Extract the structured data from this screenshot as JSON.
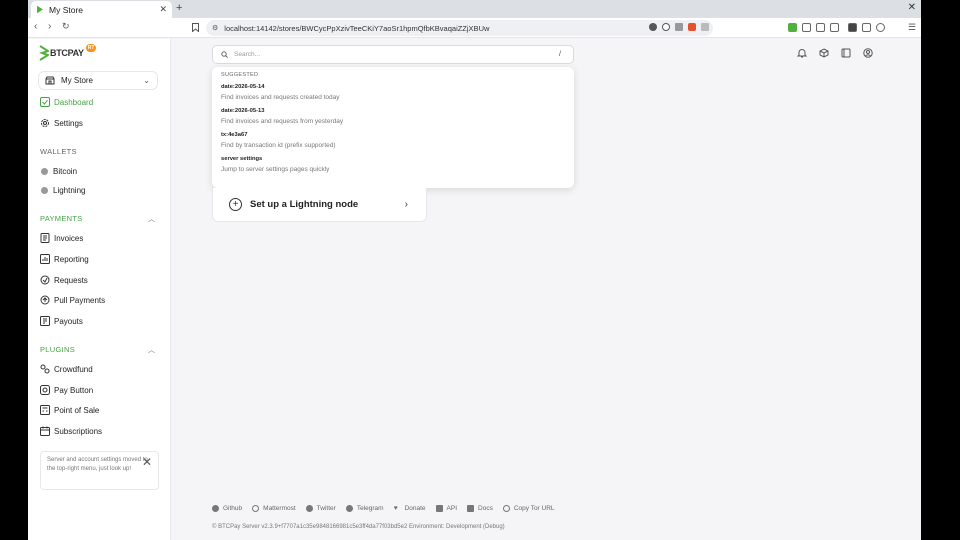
{
  "browser": {
    "tab_title": "My Store",
    "url": "localhost:14142/stores/BWCycPpXzivTeeCKiY7aoSr1hpmQfbKBvaqaiZZjXBUw"
  },
  "sidebar": {
    "logo_text": "BTCPAY",
    "logo_badge": "RT",
    "store_name": "My Store",
    "nav": [
      {
        "label": "Dashboard",
        "icon": "dashboard-icon"
      },
      {
        "label": "Settings",
        "icon": "gear-icon"
      }
    ],
    "wallets_header": "WALLETS",
    "wallets": [
      {
        "label": "Bitcoin",
        "icon": "bitcoin-icon"
      },
      {
        "label": "Lightning",
        "icon": "lightning-icon"
      }
    ],
    "payments_header": "PAYMENTS",
    "payments": [
      {
        "label": "Invoices",
        "icon": "invoice-icon"
      },
      {
        "label": "Reporting",
        "icon": "reporting-icon"
      },
      {
        "label": "Requests",
        "icon": "requests-icon"
      },
      {
        "label": "Pull Payments",
        "icon": "pull-payments-icon"
      },
      {
        "label": "Payouts",
        "icon": "payouts-icon"
      }
    ],
    "plugins_header": "PLUGINS",
    "plugins": [
      {
        "label": "Crowdfund",
        "icon": "crowdfund-icon"
      },
      {
        "label": "Pay Button",
        "icon": "pay-button-icon"
      },
      {
        "label": "Point of Sale",
        "icon": "pos-icon"
      },
      {
        "label": "Subscriptions",
        "icon": "subscriptions-icon"
      }
    ],
    "notice": "Server and account settings moved to the top-right menu, just look up!"
  },
  "search": {
    "placeholder": "Search...",
    "shortcut": "/",
    "suggested_header": "SUGGESTED",
    "suggestions": [
      {
        "key": "date:2026-05-14",
        "desc": "Find invoices and requests created today"
      },
      {
        "key": "date:2026-05-13",
        "desc": "Find invoices and requests from yesterday"
      },
      {
        "key": "tx:4e3a67",
        "desc": "Find by transaction id (prefix supported)"
      },
      {
        "key": "server settings",
        "desc": "Jump to server settings pages quickly"
      }
    ]
  },
  "main": {
    "card_label": "Set up a Lightning node"
  },
  "footer": {
    "links": [
      "Github",
      "Mattermost",
      "Twitter",
      "Telegram",
      "Donate",
      "API",
      "Docs",
      "Copy Tor URL"
    ],
    "copyright": "© BTCPay Server v2.3.9+f7707a1c35e9848166981c5e3ff4da77f03bd5e2 Environment: Development (Debug)"
  },
  "colors": {
    "accent": "#44a244",
    "bitcoin": "#f7931a"
  }
}
